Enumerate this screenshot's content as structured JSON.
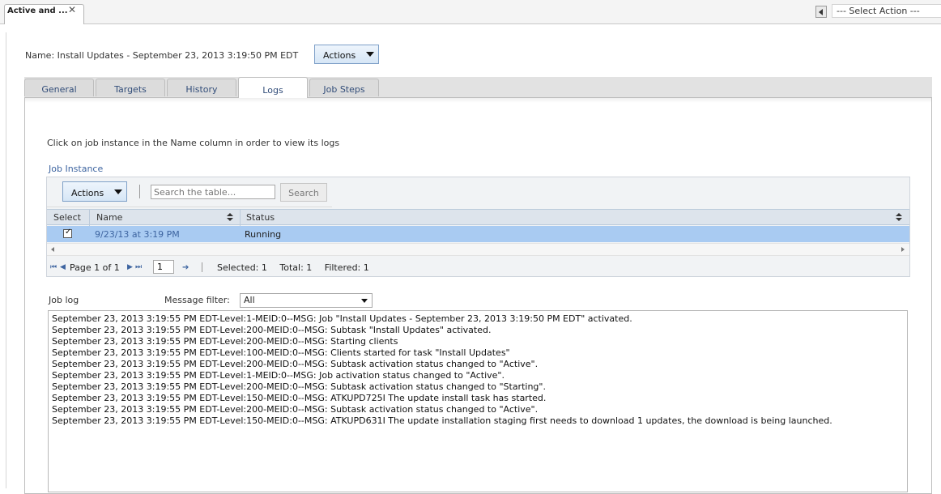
{
  "top_bar": {
    "tab_label": "Active and ...",
    "close_glyph": "✕",
    "select_action": "--- Select Action ---"
  },
  "header": {
    "name_label": "Name:  Install Updates - September 23, 2013 3:19:50 PM EDT",
    "actions_label": "Actions"
  },
  "tabs": [
    {
      "label": "General"
    },
    {
      "label": "Targets"
    },
    {
      "label": "History"
    },
    {
      "label": "Logs",
      "active": true
    },
    {
      "label": "Job Steps"
    }
  ],
  "instructions": "Click on job instance in the Name column in order to view its logs",
  "job_instance": {
    "title": "Job Instance",
    "actions_label": "Actions",
    "search_placeholder": "Search the table...",
    "search_button": "Search",
    "columns": {
      "select": "Select",
      "name": "Name",
      "status": "Status"
    },
    "rows": [
      {
        "selected": true,
        "name": "9/23/13 at 3:19 PM",
        "status": "Running"
      }
    ],
    "pager": {
      "page_text": "Page 1 of 1",
      "page_value": "1",
      "selected": "Selected: 1",
      "total": "Total: 1",
      "filtered": "Filtered: 1"
    }
  },
  "job_log": {
    "label": "Job log",
    "filter_label": "Message filter:",
    "filter_value": "All",
    "lines": [
      "September 23, 2013 3:19:55 PM EDT-Level:1-MEID:0--MSG: Job \"Install Updates - September 23, 2013 3:19:50 PM EDT\" activated.",
      "September 23, 2013 3:19:55 PM EDT-Level:200-MEID:0--MSG: Subtask \"Install Updates\" activated.",
      "September 23, 2013 3:19:55 PM EDT-Level:200-MEID:0--MSG: Starting clients",
      "September 23, 2013 3:19:55 PM EDT-Level:100-MEID:0--MSG: Clients started for task \"Install Updates\"",
      "September 23, 2013 3:19:55 PM EDT-Level:200-MEID:0--MSG: Subtask activation status changed to \"Active\".",
      "September 23, 2013 3:19:55 PM EDT-Level:1-MEID:0--MSG: Job activation status changed to \"Active\".",
      "September 23, 2013 3:19:55 PM EDT-Level:200-MEID:0--MSG: Subtask activation status changed to \"Starting\".",
      "September 23, 2013 3:19:55 PM EDT-Level:150-MEID:0--MSG: ATKUPD725I The update install task has started.",
      "September 23, 2013 3:19:55 PM EDT-Level:200-MEID:0--MSG: Subtask activation status changed to \"Active\".",
      "September 23, 2013 3:19:55 PM EDT-Level:150-MEID:0--MSG: ATKUPD631I The update installation staging first needs to download 1 updates, the download is being launched."
    ]
  },
  "icons": {
    "first_page": "⏮",
    "prev_page": "◀",
    "next_page": "▶",
    "last_page": "⏭",
    "go": "➔"
  }
}
